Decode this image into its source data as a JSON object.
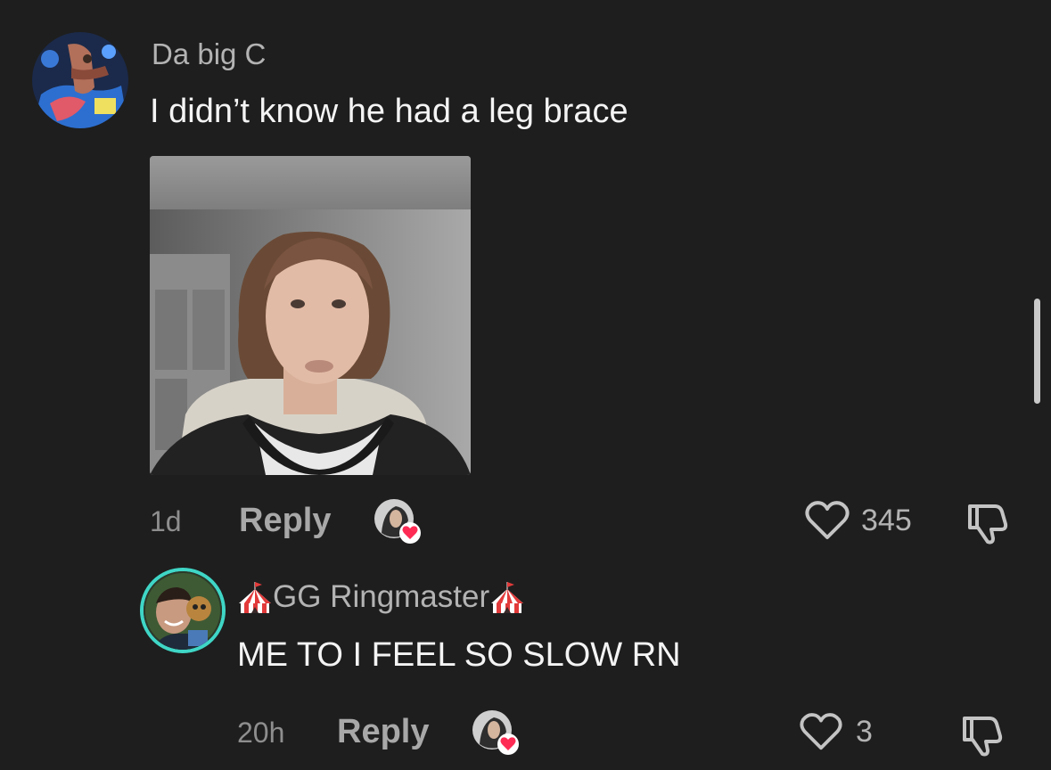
{
  "comments": [
    {
      "username": "Da big C",
      "text": "I didn’t know he had a leg brace",
      "time": "1d",
      "reply_label": "Reply",
      "likes": "345",
      "has_image": true
    },
    {
      "username": "GG Ringmaster",
      "username_emoji": "circus-tent",
      "text": "ME TO I FEEL SO SLOW RN",
      "time": "20h",
      "reply_label": "Reply",
      "likes": "3"
    }
  ],
  "colors": {
    "background": "#1e1e1e",
    "heart_badge": "#fe2c55",
    "avatar_ring": "#3fd6c6"
  }
}
